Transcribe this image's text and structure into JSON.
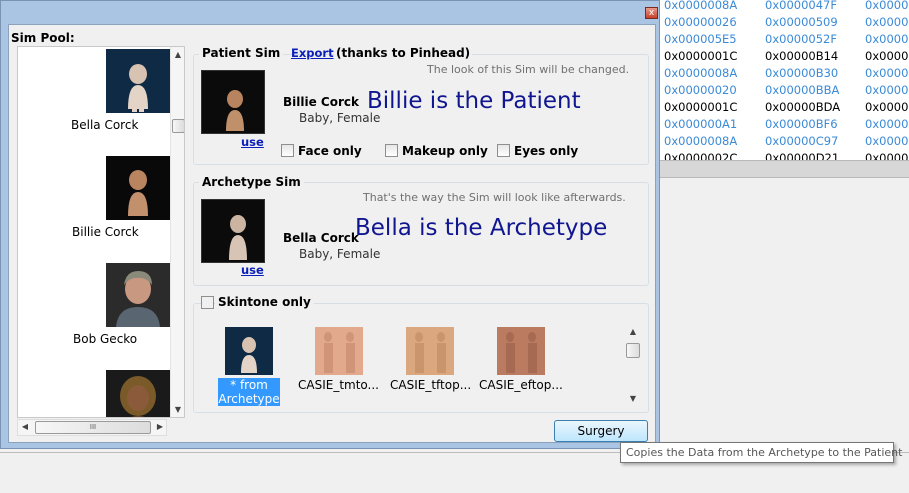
{
  "background_table": {
    "rows": [
      [
        "0x0000008A",
        "0x0000047F",
        "0x00000"
      ],
      [
        "0x00000026",
        "0x00000509",
        "0x00000"
      ],
      [
        "0x000005E5",
        "0x0000052F",
        "0x00000"
      ],
      [
        "0x0000001C",
        "0x00000B14",
        "0x00000"
      ],
      [
        "0x0000008A",
        "0x00000B30",
        "0x00000"
      ],
      [
        "0x00000020",
        "0x00000BBA",
        "0x00000"
      ],
      [
        "0x0000001C",
        "0x00000BDA",
        "0x00000"
      ],
      [
        "0x000000A1",
        "0x00000BF6",
        "0x00000"
      ],
      [
        "0x0000008A",
        "0x00000C97",
        "0x00000"
      ],
      [
        "0x0000002C",
        "0x00000D21",
        "0x00000"
      ]
    ],
    "row_colors": [
      "blue",
      "blue",
      "blue",
      "black",
      "blue",
      "blue",
      "black",
      "blue",
      "blue",
      "black"
    ],
    "colors": {
      "blue": "#3b8ad6",
      "black": "#000000"
    }
  },
  "dialog": {
    "close_label": "x"
  },
  "sim_pool": {
    "label": "Sim Pool:",
    "sims": [
      {
        "name": "Bella Corck",
        "icon": "baby-portrait"
      },
      {
        "name": "Billie Corck",
        "icon": "baby-portrait"
      },
      {
        "name": "Bob Gecko",
        "icon": "adult-male-portrait"
      },
      {
        "name": "",
        "icon": "adult-female-portrait"
      }
    ],
    "hscroll_grip": "III"
  },
  "patient": {
    "title": "Patient Sim",
    "export_label": "Export",
    "thanks": "(thanks to Pinhead)",
    "hint": "The look of this Sim will be changed.",
    "name": "Billie Corck",
    "desc": "Baby, Female",
    "use_label": "use",
    "annotation": "Billie is the Patient",
    "options": [
      "Face only",
      "Makeup only",
      "Eyes only"
    ]
  },
  "archetype": {
    "title": "Archetype Sim",
    "hint": "That's the way the Sim will look like afterwards.",
    "name": "Bella Corck",
    "desc": "Baby, Female",
    "use_label": "use",
    "annotation": "Bella is the Archetype"
  },
  "skintone": {
    "checkbox_label": "Skintone only",
    "items": [
      {
        "label_line1": "* from",
        "label_line2": "Archetype",
        "selected": true
      },
      {
        "label": "CASIE_tmto...",
        "color": "#d9967a"
      },
      {
        "label": "CASIE_tftop...",
        "color": "#d39a74"
      },
      {
        "label": "CASIE_eftop...",
        "color": "#b5765d"
      }
    ]
  },
  "surgery_label": "Surgery",
  "tooltip": "Copies the Data from the Archetype to the Patient"
}
